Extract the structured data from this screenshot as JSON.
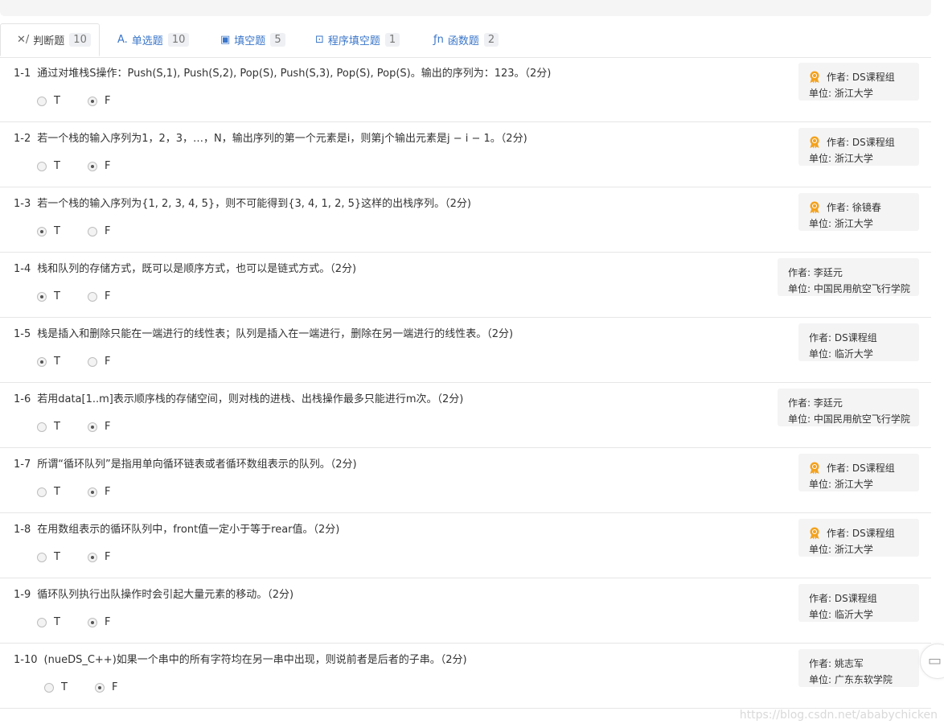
{
  "tabs": [
    {
      "label": "判断题",
      "count": "10",
      "icon": "✕/",
      "icon_name": "judge-icon"
    },
    {
      "label": "单选题",
      "count": "10",
      "icon": "A.",
      "icon_name": "single-choice-icon"
    },
    {
      "label": "填空题",
      "count": "5",
      "icon": "▣",
      "icon_name": "fill-blank-icon"
    },
    {
      "label": "程序填空题",
      "count": "1",
      "icon": "⊡",
      "icon_name": "program-fill-icon"
    },
    {
      "label": "函数题",
      "count": "2",
      "icon": "ƒn",
      "icon_name": "function-icon"
    }
  ],
  "options": {
    "true_label": "T",
    "false_label": "F"
  },
  "questions": [
    {
      "num": "1-1",
      "text": "通过对堆栈S操作：Push(S,1), Push(S,2), Pop(S), Push(S,3), Pop(S), Pop(S)。输出的序列为：123。（2分)",
      "answer": "F",
      "author": "作者: DS课程组",
      "unit": "单位: 浙江大学",
      "medal": true
    },
    {
      "num": "1-2",
      "text": "若一个栈的输入序列为1，2，3，…，N，输出序列的第一个元素是i，则第j个输出元素是j − i − 1。（2分)",
      "answer": "F",
      "author": "作者: DS课程组",
      "unit": "单位: 浙江大学",
      "medal": true
    },
    {
      "num": "1-3",
      "text": "若一个栈的输入序列为{1, 2, 3, 4, 5}，则不可能得到{3, 4, 1, 2, 5}这样的出栈序列。（2分)",
      "answer": "T",
      "author": "作者: 徐镜春",
      "unit": "单位: 浙江大学",
      "medal": true
    },
    {
      "num": "1-4",
      "text": "栈和队列的存储方式，既可以是顺序方式，也可以是链式方式。（2分)",
      "answer": "T",
      "author": "作者: 李廷元",
      "unit": "单位: 中国民用航空飞行学院",
      "medal": false
    },
    {
      "num": "1-5",
      "text": "栈是插入和删除只能在一端进行的线性表；队列是插入在一端进行，删除在另一端进行的线性表。（2分)",
      "answer": "T",
      "author": "作者: DS课程组",
      "unit": "单位: 临沂大学",
      "medal": false
    },
    {
      "num": "1-6",
      "text": "若用data[1..m]表示顺序栈的存储空间，则对栈的进栈、出栈操作最多只能进行m次。（2分)",
      "answer": "F",
      "author": "作者: 李廷元",
      "unit": "单位: 中国民用航空飞行学院",
      "medal": false
    },
    {
      "num": "1-7",
      "text": "所谓“循环队列”是指用单向循环链表或者循环数组表示的队列。（2分)",
      "answer": "F",
      "author": "作者: DS课程组",
      "unit": "单位: 浙江大学",
      "medal": true
    },
    {
      "num": "1-8",
      "text": "在用数组表示的循环队列中，front值一定小于等于rear值。（2分)",
      "answer": "F",
      "author": "作者: DS课程组",
      "unit": "单位: 浙江大学",
      "medal": true
    },
    {
      "num": "1-9",
      "text": "循环队列执行出队操作时会引起大量元素的移动。（2分)",
      "answer": "F",
      "author": "作者: DS课程组",
      "unit": "单位: 临沂大学",
      "medal": false
    },
    {
      "num": "1-10",
      "text": "(nueDS_C++)如果一个串中的所有字符均在另一串中出现，则说前者是后者的子串。（2分)",
      "answer": "F",
      "author": "作者: 姚志军",
      "unit": "单位: 广东东软学院",
      "medal": false
    }
  ],
  "watermark": "https://blog.csdn.net/ababychicken",
  "colors": {
    "tab_link": "#3a76c9",
    "author_bg": "#f4f4f5",
    "medal": "#f0a020"
  }
}
